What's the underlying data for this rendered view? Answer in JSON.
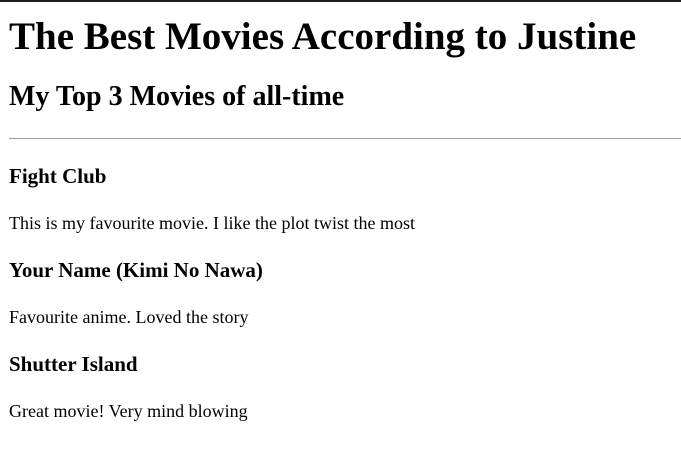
{
  "page": {
    "title": "The Best Movies According to Justine",
    "subtitle": "My Top 3 Movies of all-time"
  },
  "movies": [
    {
      "title": "Fight Club",
      "description": "This is my favourite movie. I like the plot twist the most"
    },
    {
      "title": "Your Name (Kimi No Nawa)",
      "description": "Favourite anime. Loved the story"
    },
    {
      "title": "Shutter Island",
      "description": "Great movie! Very mind blowing"
    }
  ]
}
